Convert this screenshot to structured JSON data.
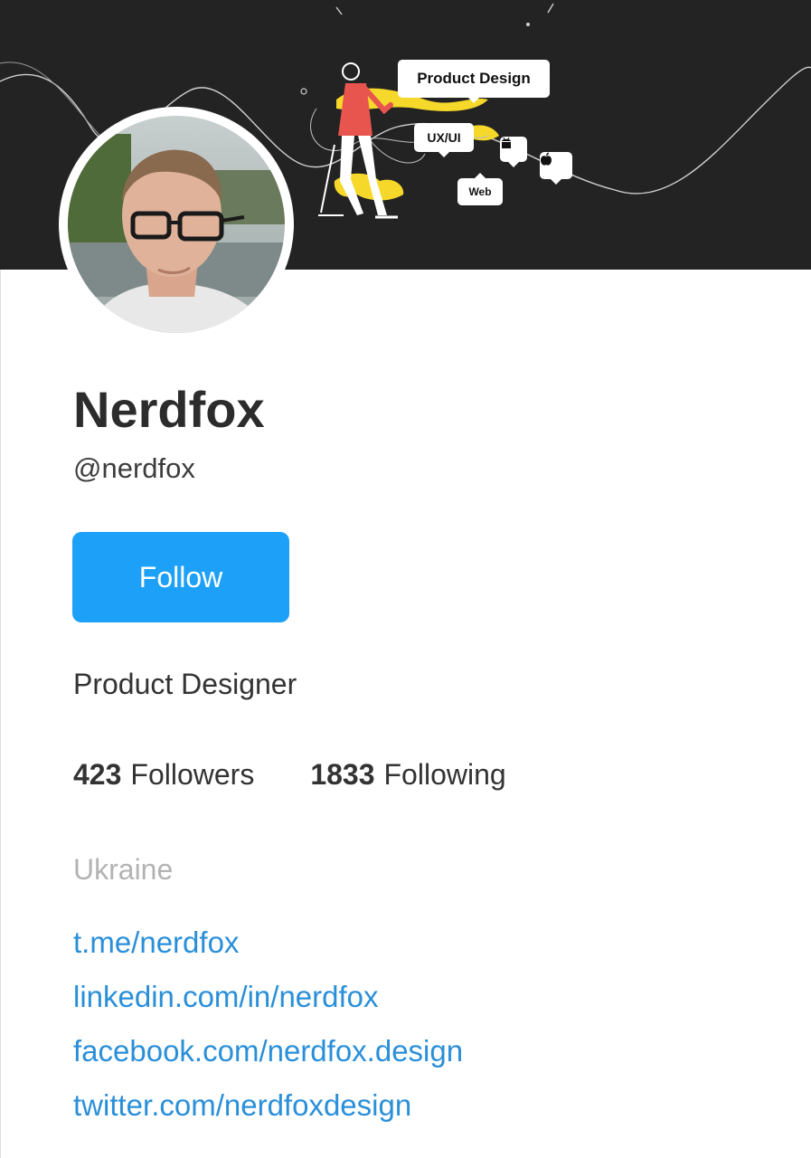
{
  "cover": {
    "tags": {
      "product_design": "Product Design",
      "ux_ui": "UX/UI",
      "web": "Web"
    },
    "icons": [
      "android-icon",
      "apple-icon"
    ],
    "accent_yellow": "#f5d82a",
    "accent_red": "#e8554e",
    "background": "#232323"
  },
  "profile": {
    "name": "Nerdfox",
    "handle": "@nerdfox",
    "bio": "Product Designer",
    "location": "Ukraine"
  },
  "actions": {
    "follow_label": "Follow",
    "button_color": "#1da1f8"
  },
  "stats": {
    "followers_count": "423",
    "followers_label": "Followers",
    "following_count": "1833",
    "following_label": "Following"
  },
  "links": [
    "t.me/nerdfox",
    "linkedin.com/in/nerdfox",
    "facebook.com/nerdfox.design",
    "twitter.com/nerdfoxdesign"
  ],
  "link_color": "#2a8fd9"
}
